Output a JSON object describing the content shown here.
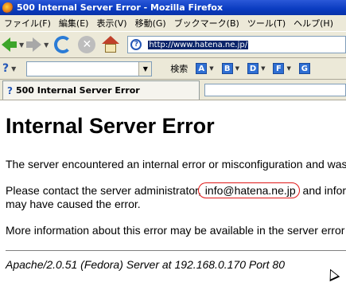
{
  "window": {
    "title": "500 Internal Server Error - Mozilla Firefox"
  },
  "menu": {
    "items": [
      "ファイル(F)",
      "編集(E)",
      "表示(V)",
      "移動(G)",
      "ブックマーク(B)",
      "ツール(T)",
      "ヘルプ(H)"
    ]
  },
  "navbar": {
    "url": "http://www.hatena.ne.jp/"
  },
  "searchbar": {
    "search_label": "検索",
    "letter_buttons": [
      "A",
      "B",
      "D",
      "F",
      "G"
    ]
  },
  "tab": {
    "title": "500 Internal Server Error"
  },
  "page": {
    "heading": "Internal Server Error",
    "paragraph1": "The server encountered an internal error or misconfiguration and was unable to complete your request.",
    "paragraph2_before": "Please contact the server administrator,",
    "paragraph2_email": " info@hatena.ne.jp",
    "paragraph2_after": " and inform them of the time the error occurred, and anything you might have done that",
    "paragraph2_line2": "may have caused the error.",
    "paragraph3": "More information about this error may be available in the server error log.",
    "address": "Apache/2.0.51 (Fedora) Server at 192.168.0.170 Port 80"
  },
  "colors": {
    "titlebar": "#0a3bc0",
    "chrome": "#ece9d8",
    "url_highlight": "#0a246a",
    "email_circle": "#e01818"
  }
}
